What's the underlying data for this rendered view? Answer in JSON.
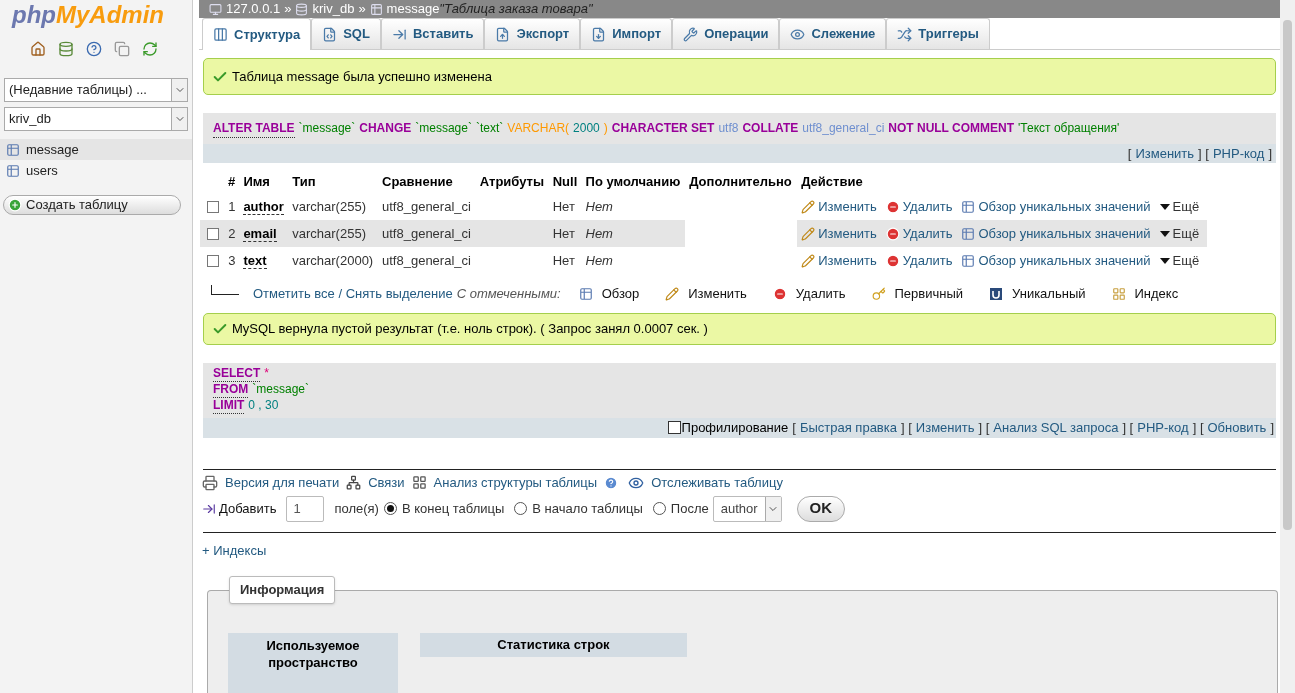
{
  "logo": {
    "part_1": "php",
    "part_2": "MyAdmin"
  },
  "sidebar": {
    "recent_select": "(Недавние таблицы) ...",
    "db_select": "kriv_db",
    "tables": [
      {
        "name": "message",
        "selected": true
      },
      {
        "name": "users",
        "selected": false
      }
    ],
    "create_button": "Создать таблицу"
  },
  "breadcrumb": [
    {
      "kind": "server",
      "text": "127.0.0.1"
    },
    {
      "kind": "separator",
      "text": "»"
    },
    {
      "kind": "database",
      "text": "kriv_db"
    },
    {
      "kind": "separator",
      "text": "»"
    },
    {
      "kind": "table",
      "text": "message"
    },
    {
      "kind": "comment",
      "text": "\"Таблица заказа товара\""
    }
  ],
  "tabs": [
    {
      "label": "Структура",
      "selected": true
    },
    {
      "label": "SQL",
      "selected": false
    },
    {
      "label": "Вставить",
      "selected": false
    },
    {
      "label": "Экспорт",
      "selected": false
    },
    {
      "label": "Импорт",
      "selected": false
    },
    {
      "label": "Операции",
      "selected": false
    },
    {
      "label": "Слежение",
      "selected": false
    },
    {
      "label": "Триггеры",
      "selected": false
    }
  ],
  "success_1": "Таблица message была успешно изменена",
  "query_1": {
    "lines": [
      [
        {
          "kind": "keyword",
          "text": "ALTER TABLE"
        },
        {
          "kind": "identifier",
          "text": "`message`"
        },
        {
          "kind": "keyword",
          "text": "CHANGE"
        },
        {
          "kind": "identifier",
          "text": "`message`"
        },
        {
          "kind": "identifier",
          "text": "`text`"
        },
        {
          "kind": "type",
          "text": "VARCHAR("
        },
        {
          "kind": "number",
          "text": "2000"
        },
        {
          "kind": "type",
          "text": ")"
        },
        {
          "kind": "keyword",
          "text": "CHARACTER SET"
        },
        {
          "kind": "charset",
          "text": "utf8"
        },
        {
          "kind": "keyword",
          "text": "COLLATE"
        },
        {
          "kind": "charset",
          "text": "utf8_general_ci"
        },
        {
          "kind": "keyword",
          "text": "NOT NULL COMMENT"
        },
        {
          "kind": "identifier",
          "text": "'Текст обращения'"
        }
      ]
    ],
    "links": [
      {
        "kind": "plain",
        "text": "["
      },
      {
        "kind": "link",
        "text": "Изменить"
      },
      {
        "kind": "plain",
        "text": "] ["
      },
      {
        "kind": "link",
        "text": "PHP-код"
      },
      {
        "kind": "plain",
        "text": "]"
      }
    ]
  },
  "table": {
    "columns": [
      "#",
      "Имя",
      "Тип",
      "Сравнение",
      "Атрибуты",
      "Null",
      "По умолчанию",
      "Дополнительно",
      "Действие"
    ],
    "rows": [
      {
        "checked": false,
        "num": "1",
        "name": "author",
        "type": "varchar(255)",
        "collation": "utf8_general_ci",
        "null": "Нет",
        "default": "Нет",
        "actions": [
          "Изменить",
          "Удалить",
          "Обзор уникальных значений",
          "Ещё"
        ]
      },
      {
        "checked": false,
        "num": "2",
        "name": "email",
        "type": "varchar(255)",
        "collation": "utf8_general_ci",
        "null": "Нет",
        "default": "Нет",
        "actions": [
          "Изменить",
          "Удалить",
          "Обзор уникальных значений",
          "Ещё"
        ]
      },
      {
        "checked": false,
        "num": "3",
        "name": "text",
        "type": "varchar(2000)",
        "collation": "utf8_general_ci",
        "null": "Нет",
        "default": "Нет",
        "actions": [
          "Изменить",
          "Удалить",
          "Обзор уникальных значений",
          "Ещё"
        ]
      }
    ]
  },
  "bulk": {
    "check_all": "Отметить все / Снять выделение",
    "with_selected": "С отмеченными:",
    "actions": [
      "Обзор",
      "Изменить",
      "Удалить",
      "Первичный",
      "Уникальный",
      "Индекс"
    ]
  },
  "success_2": "MySQL вернула пустой результат (т.е. ноль строк). ( Запрос занял 0.0007 сек. )",
  "query_2": {
    "lines": [
      [
        {
          "kind": "keyword",
          "text": "SELECT"
        },
        {
          "kind": "operator",
          "text": "*"
        }
      ],
      [
        {
          "kind": "keyword",
          "text": "FROM"
        },
        {
          "kind": "identifier",
          "text": "`message`"
        }
      ],
      [
        {
          "kind": "keyword",
          "text": "LIMIT"
        },
        {
          "kind": "number",
          "text": "0 , 30"
        }
      ]
    ],
    "profiling": {
      "label": "Профилирование",
      "checked": false
    },
    "links": [
      {
        "kind": "plain",
        "text": "["
      },
      {
        "kind": "link",
        "text": "Быстрая правка"
      },
      {
        "kind": "plain",
        "text": "] ["
      },
      {
        "kind": "link",
        "text": "Изменить"
      },
      {
        "kind": "plain",
        "text": "] ["
      },
      {
        "kind": "link",
        "text": "Анализ SQL запроса"
      },
      {
        "kind": "plain",
        "text": "] ["
      },
      {
        "kind": "link",
        "text": "PHP-код"
      },
      {
        "kind": "plain",
        "text": "] ["
      },
      {
        "kind": "link",
        "text": "Обновить"
      },
      {
        "kind": "plain",
        "text": "]"
      }
    ]
  },
  "table_links": [
    "Версия для печати",
    "Связи",
    "Анализ структуры таблицы",
    "Отслеживать таблицу"
  ],
  "add_field": {
    "label": "Добавить",
    "count": "1",
    "unit": "поле(я)",
    "positions": [
      {
        "label": "В конец таблицы",
        "selected": true
      },
      {
        "label": "В начало таблицы",
        "selected": false
      },
      {
        "label": "После",
        "selected": false
      }
    ],
    "after": "author",
    "ok": "OK"
  },
  "indexes": "+ Индексы",
  "info": {
    "title": "Информация",
    "headers": [
      "Используемое пространство",
      "Статистика строк"
    ]
  }
}
